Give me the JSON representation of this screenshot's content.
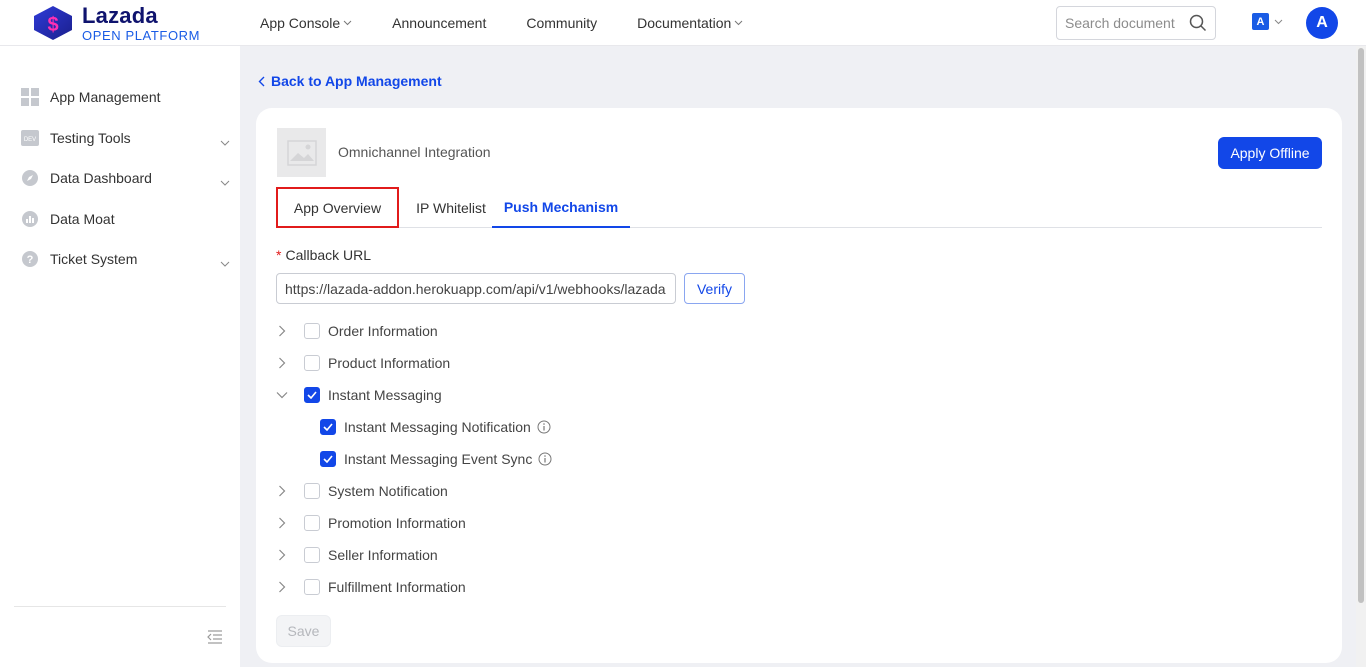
{
  "brand": {
    "name": "Lazada",
    "sub": "OPEN PLATFORM"
  },
  "topnav": [
    {
      "label": "App Console",
      "dropdown": true
    },
    {
      "label": "Announcement",
      "dropdown": false
    },
    {
      "label": "Community",
      "dropdown": false
    },
    {
      "label": "Documentation",
      "dropdown": true
    }
  ],
  "search": {
    "placeholder": "Search document"
  },
  "lang": {
    "glyph": "A"
  },
  "user": {
    "initial": "A"
  },
  "sidebar": {
    "items": [
      {
        "label": "App Management",
        "icon": "grid-icon",
        "expandable": false
      },
      {
        "label": "Testing Tools",
        "icon": "dev-icon",
        "expandable": true
      },
      {
        "label": "Data Dashboard",
        "icon": "compass-icon",
        "expandable": true
      },
      {
        "label": "Data Moat",
        "icon": "chart-icon",
        "expandable": false
      },
      {
        "label": "Ticket System",
        "icon": "help-icon",
        "expandable": true
      }
    ]
  },
  "back": {
    "label": "Back to App Management"
  },
  "app": {
    "name": "Omnichannel Integration",
    "apply_label": "Apply Offline"
  },
  "tabs": [
    {
      "label": "App Overview"
    },
    {
      "label": "IP Whitelist"
    },
    {
      "label": "Push Mechanism",
      "active": true
    }
  ],
  "callback": {
    "required_mark": "*",
    "label": "Callback URL",
    "value": "https://lazada-addon.herokuapp.com/api/v1/webhooks/lazada",
    "verify_label": "Verify"
  },
  "tree": [
    {
      "label": "Order Information",
      "checked": false,
      "expanded": false
    },
    {
      "label": "Product Information",
      "checked": false,
      "expanded": false
    },
    {
      "label": "Instant Messaging",
      "checked": true,
      "expanded": true,
      "children": [
        {
          "label": "Instant Messaging Notification",
          "checked": true
        },
        {
          "label": "Instant Messaging Event Sync",
          "checked": true
        }
      ]
    },
    {
      "label": "System Notification",
      "checked": false,
      "expanded": false
    },
    {
      "label": "Promotion Information",
      "checked": false,
      "expanded": false
    },
    {
      "label": "Seller Information",
      "checked": false,
      "expanded": false
    },
    {
      "label": "Fulfillment Information",
      "checked": false,
      "expanded": false
    }
  ],
  "save_label": "Save",
  "colors": {
    "primary": "#1247e8",
    "highlight_border": "#e11b1b",
    "brand_dark": "#0f136e"
  }
}
